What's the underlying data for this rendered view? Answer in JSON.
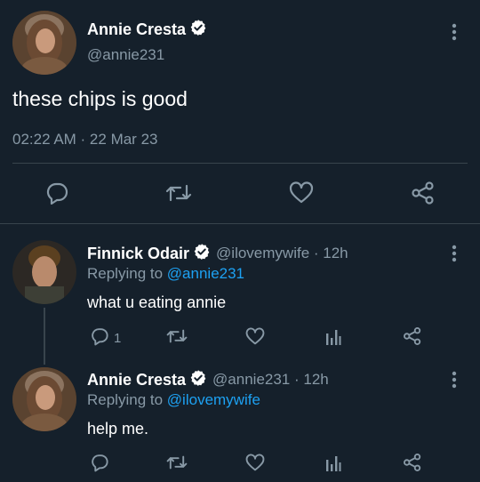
{
  "main_tweet": {
    "display_name": "Annie Cresta",
    "handle": "@annie231",
    "text": "these chips is good",
    "timestamp": "02:22 AM · 22 Mar 23",
    "icons": [
      "reply-icon",
      "retweet-icon",
      "like-icon",
      "share-icon",
      "more-icon",
      "verified-icon"
    ]
  },
  "replies": [
    {
      "display_name": "Finnick Odair",
      "handle_time": "@ilovemywife · 12h",
      "replying_prefix": "Replying to",
      "replying_to": "@annie231",
      "text": "what u eating annie",
      "reply_count": "1"
    },
    {
      "display_name": "Annie Cresta",
      "handle_time": "@annie231 · 12h",
      "replying_prefix": "Replying to",
      "replying_to": "@ilovemywife",
      "text": "help me."
    }
  ],
  "colors": {
    "background": "#15202b",
    "text": "#ffffff",
    "muted": "#8899a6",
    "link": "#1da1f2",
    "divider": "#38444d"
  }
}
